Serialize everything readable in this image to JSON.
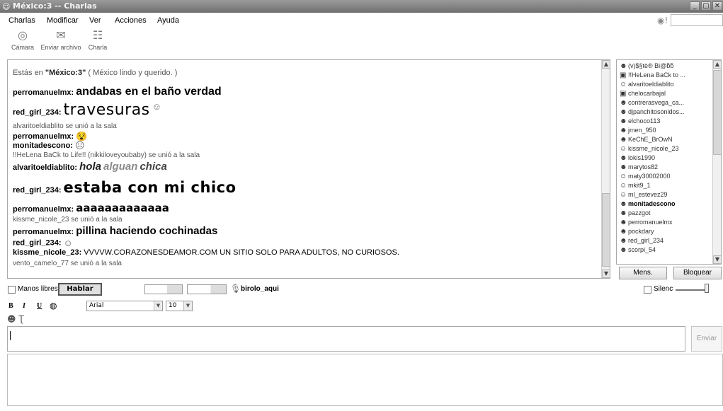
{
  "window": {
    "title": "México:3 -- Charlas"
  },
  "menu": [
    {
      "label": "Charlas"
    },
    {
      "label": "Modificar"
    },
    {
      "label": "Ver"
    },
    {
      "label": "Acciones"
    },
    {
      "label": "Ayuda"
    }
  ],
  "toolbar": {
    "camera_label": "Cámara",
    "send_file_label": "Enviar archivo",
    "chat_label": "Charla"
  },
  "chat": {
    "status_prefix": "Estás en ",
    "room": "\"México:3\"",
    "room_desc": " ( México lindo y querido. )",
    "lines": [
      {
        "nick": "perromanuelmx:",
        "text": "andabas en el baño verdad"
      },
      {
        "nick": "red_girl_234:",
        "text": "travesuras"
      },
      {
        "join": "alvaritoeldiablito se unió a la sala"
      },
      {
        "nick": "perromanuelmx:",
        "emoticon": "😵"
      },
      {
        "nick": "monitadescono:",
        "emoticon": "☹"
      },
      {
        "join": "!!HeLena BaCk to Life!! (nikkiloveyoubaby) se unió a la sala"
      },
      {
        "nick": "alvaritoeldiablito:",
        "part1": "hola",
        "part2": "alguan",
        "part3": "chica"
      },
      {
        "nick": "red_girl_234:",
        "text": "estaba con mi chico"
      },
      {
        "nick": "perromanuelmx:",
        "text": "aaaaaaaaaaaaa"
      },
      {
        "join": "kissme_nicole_23 se unió a la sala"
      },
      {
        "nick": "perromanuelmx:",
        "text": "pillina haciendo cochinadas"
      },
      {
        "nick": "red_girl_234:",
        "emoticon": "☺"
      },
      {
        "nick": "kissme_nicole_23:",
        "text": "VVVVW.CORAZONESDEAMOR.COM UN SITIO SOLO PARA ADULTOS, NO CURIOSOS."
      },
      {
        "join": "vento_camelo_77 se unió a la sala"
      }
    ]
  },
  "users": [
    "(v)$§tè® Bi@ƃƃ",
    "!!HeLena BaCk to ...",
    "alvaritoeldiablito",
    "chelocarbajal",
    "contrerasvega_ca...",
    "djpanchitosonidos...",
    "elchoco113",
    "jmen_950",
    "KeChE_BrOwN",
    "kissme_nicole_23",
    "lokis1990",
    "marytos82",
    "maty30002000",
    "mkit9_1",
    "ml_estevez29",
    "monitadescono",
    "pazzgot",
    "perromanuelmx",
    "pockdary",
    "red_girl_234",
    "scorpi_54"
  ],
  "panel": {
    "mens_label": "Mens.",
    "bloquear_label": "Bloquear"
  },
  "voice": {
    "manos_libres": "Manos libres",
    "hablar": "Hablar",
    "speaker": "birolo_aqui",
    "silenc": "Silenc"
  },
  "format": {
    "bold": "B",
    "italic": "I",
    "underline": "U",
    "font": "Arial",
    "size": "10"
  },
  "send_label": "Enviar"
}
